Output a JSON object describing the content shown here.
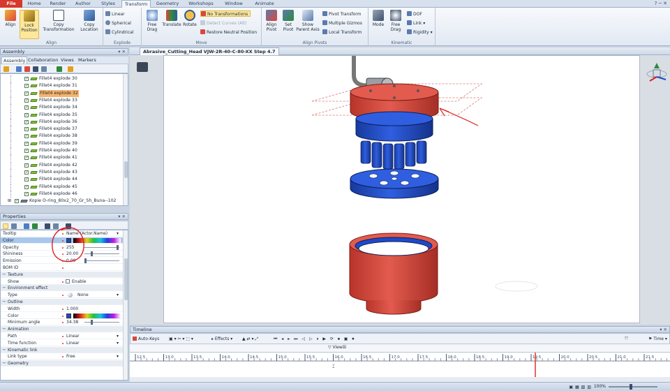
{
  "ribbon": {
    "tabs": [
      "File",
      "Home",
      "Render",
      "Author",
      "Styles",
      "Transform",
      "Geometry",
      "Workshops",
      "Window",
      "Animate"
    ],
    "active_tab": "Transform",
    "groups": {
      "align": {
        "label": "Align",
        "align": "Align",
        "lock_position": "Lock Position",
        "copy_transformation": "Copy Transformation",
        "copy_location": "Copy Location"
      },
      "explode": {
        "label": "Explode",
        "linear": "Linear",
        "spherical": "Spherical",
        "cylindrical": "Cylindrical"
      },
      "move": {
        "label": "Move",
        "free_drag": "Free Drag",
        "translate": "Translate",
        "rotate": "Rotate",
        "no_transformations": "No Transformations",
        "detect_curves": "Detect Curves (Alt)",
        "restore_neutral": "Restore Neutral Position"
      },
      "align_pivots": {
        "label": "Align Pivots",
        "align_pivot": "Align Pivot",
        "set_pivot": "Set Pivot",
        "show_parent_axis": "Show Parent Axis",
        "pivot_transform": "Pivot Transform",
        "multiple_gizmos": "Multiple Gizmos",
        "local_transform": "Local Transform"
      },
      "kinematic": {
        "label": "Kinematic",
        "mode": "Mode",
        "free_drag": "Free Drag",
        "dof": "DOF",
        "link": "Link",
        "rigidity": "Rigidity"
      }
    }
  },
  "assembly": {
    "title": "Assembly",
    "tabs": [
      "Assembly",
      "Collaboration",
      "Views",
      "Markers"
    ],
    "active_tab": "Assembly",
    "items": [
      "Fillet4 explode 30",
      "Fillet4 explode 31",
      "Fillet4 explode 32",
      "Fillet4 explode 33",
      "Fillet4 explode 34",
      "Fillet4 explode 35",
      "Fillet4 explode 36",
      "Fillet4 explode 37",
      "Fillet4 explode 38",
      "Fillet4 explode 39",
      "Fillet4 explode 40",
      "Fillet4 explode 41",
      "Fillet4 explode 42",
      "Fillet4 explode 43",
      "Fillet4 explode 44",
      "Fillet4 explode 45",
      "Fillet4 explode 46"
    ],
    "highlighted_index": 2,
    "last_item": "Kopie O-ring_80x2_70_Gr_Sh_Buna--102"
  },
  "properties": {
    "title": "Properties",
    "rows": [
      {
        "key": "Tooltip",
        "value": "Name (Actor.Name)",
        "type": "field"
      },
      {
        "key": "Color",
        "value": "",
        "type": "color",
        "selected": true
      },
      {
        "key": "Opacity",
        "value": "255",
        "type": "slider",
        "pct": 1.0
      },
      {
        "key": "Shininess",
        "value": "20.00",
        "type": "slider",
        "pct": 0.2
      },
      {
        "key": "Emission",
        "value": "0.00",
        "type": "slider",
        "pct": 0.0
      },
      {
        "key": "BOM ID",
        "value": "",
        "type": "field"
      },
      {
        "key": "Texture",
        "value": "",
        "type": "cat"
      },
      {
        "key": "Show",
        "value": "Enable",
        "type": "check"
      },
      {
        "key": "Environment effect",
        "value": "",
        "type": "cat"
      },
      {
        "key": "Type",
        "value": "None",
        "type": "sphere"
      },
      {
        "key": "Outline",
        "value": "",
        "type": "cat"
      },
      {
        "key": "Width",
        "value": "1.000",
        "type": "field"
      },
      {
        "key": "Color",
        "value": "",
        "type": "color"
      },
      {
        "key": "Minimum angle",
        "value": "34.38",
        "type": "slider",
        "pct": 0.2
      },
      {
        "key": "Animation",
        "value": "",
        "type": "cat"
      },
      {
        "key": "Path",
        "value": "Linear",
        "type": "select"
      },
      {
        "key": "Time function",
        "value": "Linear",
        "type": "select"
      },
      {
        "key": "Kinematic link",
        "value": "",
        "type": "cat"
      },
      {
        "key": "Link type",
        "value": "Free",
        "type": "select"
      },
      {
        "key": "Geometry",
        "value": "",
        "type": "cat"
      }
    ]
  },
  "viewport": {
    "tab_title": "Abrasive_Cutting_Head VJW-2R-40-C-80-XX Step 4.7",
    "colors": {
      "red_part": "#d9483c",
      "blue_part": "#1f49c6",
      "annotation": "#d92020"
    }
  },
  "timeline": {
    "title": "Timeline",
    "auto_keys": "Auto-Keys",
    "effects": "Effects",
    "view_label": "View",
    "time_label": "Time",
    "ticks": [
      "12.5",
      "13.0",
      "13.5",
      "14.0",
      "14.5",
      "15.0",
      "15.5",
      "16.0",
      "16.5",
      "17.0",
      "17.5",
      "18.0",
      "18.5",
      "19.0",
      "19.5",
      "20.0",
      "20.5",
      "21.0",
      "21.5"
    ],
    "playhead": "19.5"
  },
  "status": {
    "zoom": "100%"
  }
}
